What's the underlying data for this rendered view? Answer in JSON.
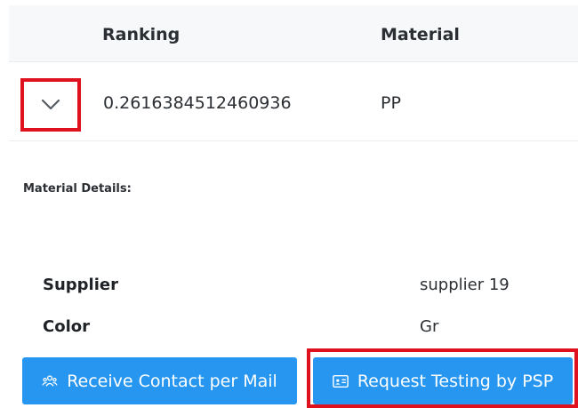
{
  "table": {
    "columns": [
      "Ranking",
      "Material"
    ],
    "row": {
      "ranking": "0.2616384512460936",
      "material": "PP"
    }
  },
  "details": {
    "title": "Material Details:",
    "fields": [
      {
        "label": "Supplier",
        "value": "supplier 19"
      },
      {
        "label": "Color",
        "value": "Gr"
      }
    ]
  },
  "actions": {
    "receive_contact": "Receive Contact per Mail",
    "request_testing": "Request Testing by PSP"
  },
  "icons": {
    "expand": "chevron-down-icon",
    "contacts": "team-icon",
    "id_card": "id-card-icon"
  },
  "colors": {
    "primary_button": "#2696f0",
    "highlight": "#e0111f",
    "header_bg": "#f7f8f9"
  }
}
